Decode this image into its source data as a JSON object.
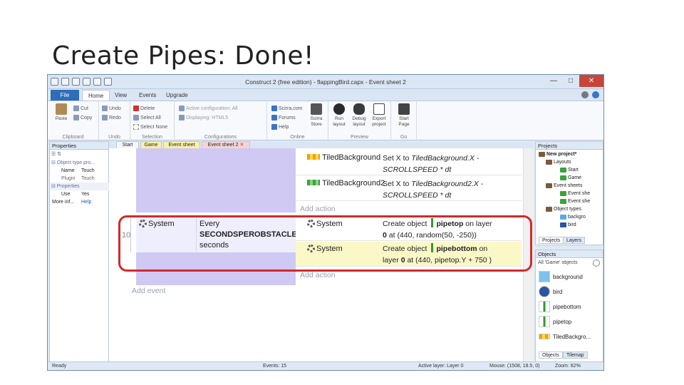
{
  "slide": {
    "title": "Create Pipes: Done!"
  },
  "window": {
    "title": "Construct 2  (free edition) - flappingBird.capx - Event sheet 2",
    "minimize": "—",
    "maximize": "□",
    "close": "✕"
  },
  "ribbon_tabs": [
    "File",
    "Home",
    "View",
    "Events",
    "Upgrade"
  ],
  "ribbon": {
    "clipboard": {
      "paste": "Paste",
      "cut": "Cut",
      "copy": "Copy",
      "label": "Clipboard"
    },
    "undo": {
      "undo": "Undo",
      "redo": "Redo",
      "label": "Undo"
    },
    "selection": {
      "delete": "Delete",
      "select_all": "Select All",
      "select_none": "Select None",
      "label": "Selection"
    },
    "configurations": {
      "active": "Active configuration: All",
      "displaying": "Displaying: HTML5",
      "label": "Configurations"
    },
    "online": {
      "scirra": "Scirra.com",
      "forums": "Forums",
      "help": "Help",
      "store": "Scirra Store",
      "label": "Online"
    },
    "preview": {
      "run": "Run layout",
      "debug": "Debug layout",
      "export": "Export project",
      "label": "Preview"
    },
    "go": {
      "start": "Start Page",
      "label": "Go"
    }
  },
  "properties_panel": {
    "title": "Properties",
    "section1": "Object type pro...",
    "name_key": "Name",
    "name_val": "Touch",
    "plugin_key": "Plugin",
    "plugin_val": "Touch",
    "section2": "Properties",
    "use_key": "Use",
    "use_val": "Yes",
    "more_info": "More inf...",
    "help": "Help"
  },
  "doc_tabs": [
    "Start",
    "Game",
    "Event sheet 1",
    "Event sheet 2"
  ],
  "sheet": {
    "actions_top": [
      {
        "object": "TiledBackground",
        "prefix": "Set X to ",
        "expr": "TiledBackground.X - SCROLLSPEED * dt"
      },
      {
        "object": "TiledBackground2",
        "prefix": "Set X to ",
        "expr": "TiledBackground2.X - SCROLLSPEED * dt"
      }
    ],
    "add_action": "Add action",
    "event_number": "10",
    "condition": {
      "object": "System",
      "line1": "Every",
      "line2": "SECONDSPEROBSTACLE",
      "line3": "seconds"
    },
    "actions": [
      {
        "object": "System",
        "text_a": "Create object",
        "obj": "pipetop",
        "text_b": "on layer",
        "layer": "0",
        "at": "at (440, random(50, -250))"
      },
      {
        "object": "System",
        "text_a": "Create object",
        "obj": "pipebottom",
        "text_b": "on",
        "layer_line": "layer",
        "layer": "0",
        "at": "at (440, pipetop.Y + 750 )"
      }
    ],
    "add_action_2": "Add action",
    "add_event": "Add event"
  },
  "projects_panel": {
    "title": "Projects",
    "root": "New project*",
    "layouts": "Layouts",
    "layout_items": [
      "Start",
      "Game"
    ],
    "event_sheets": "Event sheets",
    "sheet_items": [
      "Event she",
      "Event she"
    ],
    "object_types": "Object types",
    "object_items": [
      "backgro",
      "bird"
    ],
    "tabs": [
      "Projects",
      "Layers"
    ]
  },
  "objects_panel": {
    "title": "Objects",
    "filter": "All 'Game' objects",
    "items": [
      "background",
      "bird",
      "pipebottom",
      "pipetop",
      "TiledBackgro..."
    ],
    "tabs": [
      "Objects",
      "Tilemap"
    ]
  },
  "status": {
    "ready": "Ready",
    "events": "Events: 15",
    "layer": "Active layer: Layer 0",
    "mouse": "Mouse: (1508, 18.5, 0)",
    "zoom": "Zoom: 82%"
  },
  "colors": {
    "highlight": "#d22a2a",
    "event_side": "#cfc9f4",
    "ribbon_file": "#2e6db8"
  }
}
